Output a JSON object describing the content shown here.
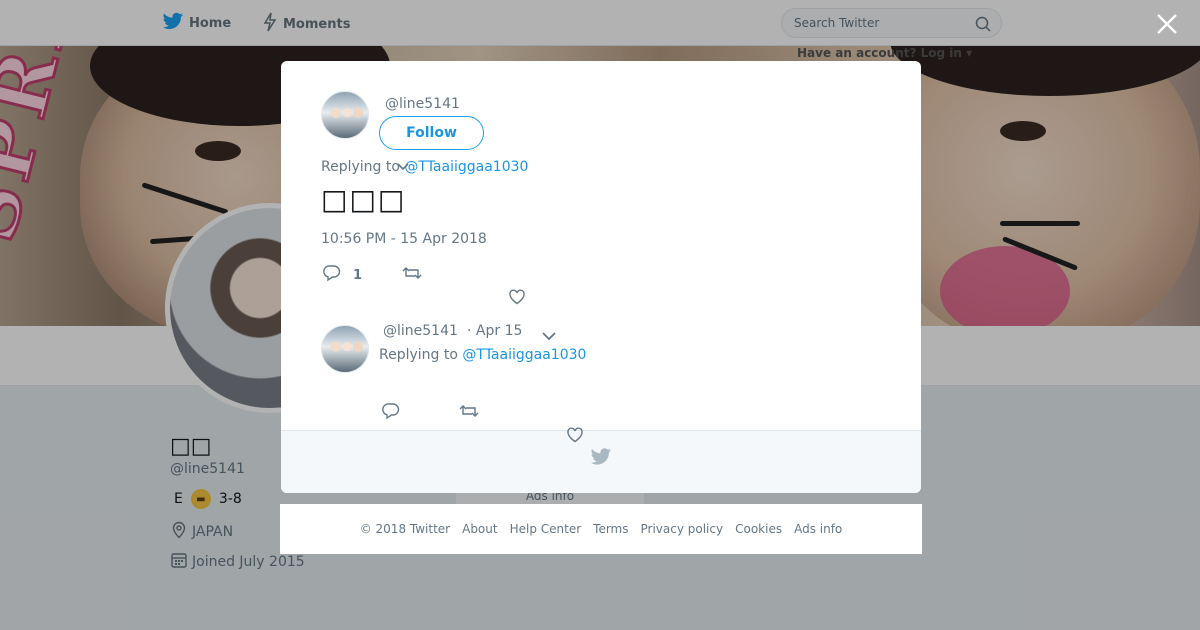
{
  "topbar": {
    "home_label": "Home",
    "moments_label": "Moments",
    "search_placeholder": "Search Twitter",
    "login_text": "Have an account? Log in ▾"
  },
  "banner": {
    "text": "SPRING"
  },
  "profile": {
    "name": "□□",
    "handle": "@line5141",
    "bio_prefix": "E",
    "bio_emoji": "😬",
    "bio_suffix": "3-8",
    "location": "JAPAN",
    "joined": "Joined July 2015",
    "ads_info": "Ads info"
  },
  "modal": {
    "tweet": {
      "handle": "@line5141",
      "follow_label": "Follow",
      "replying_prefix": "Replying to ",
      "replying_to": "@TTaaiiggaa1030",
      "text": "□□□",
      "timestamp": "10:56 PM - 15 Apr 2018",
      "reply_count": "1"
    },
    "reply": {
      "handle": "@line5141",
      "date": "· Apr 15",
      "replying_prefix": "Replying to ",
      "replying_to": "@TTaaiiggaa1030"
    }
  },
  "footer": {
    "items": [
      "© 2018 Twitter",
      "About",
      "Help Center",
      "Terms",
      "Privacy policy",
      "Cookies",
      "Ads info"
    ]
  },
  "colors": {
    "accent": "#1da1f2",
    "link": "#1b95e0",
    "muted": "#657786"
  },
  "icons": [
    "twitter-bird-icon",
    "moments-bolt-icon",
    "search-icon",
    "close-icon",
    "reply-icon",
    "retweet-icon",
    "heart-icon",
    "chevron-down-icon",
    "location-pin-icon",
    "calendar-icon"
  ]
}
